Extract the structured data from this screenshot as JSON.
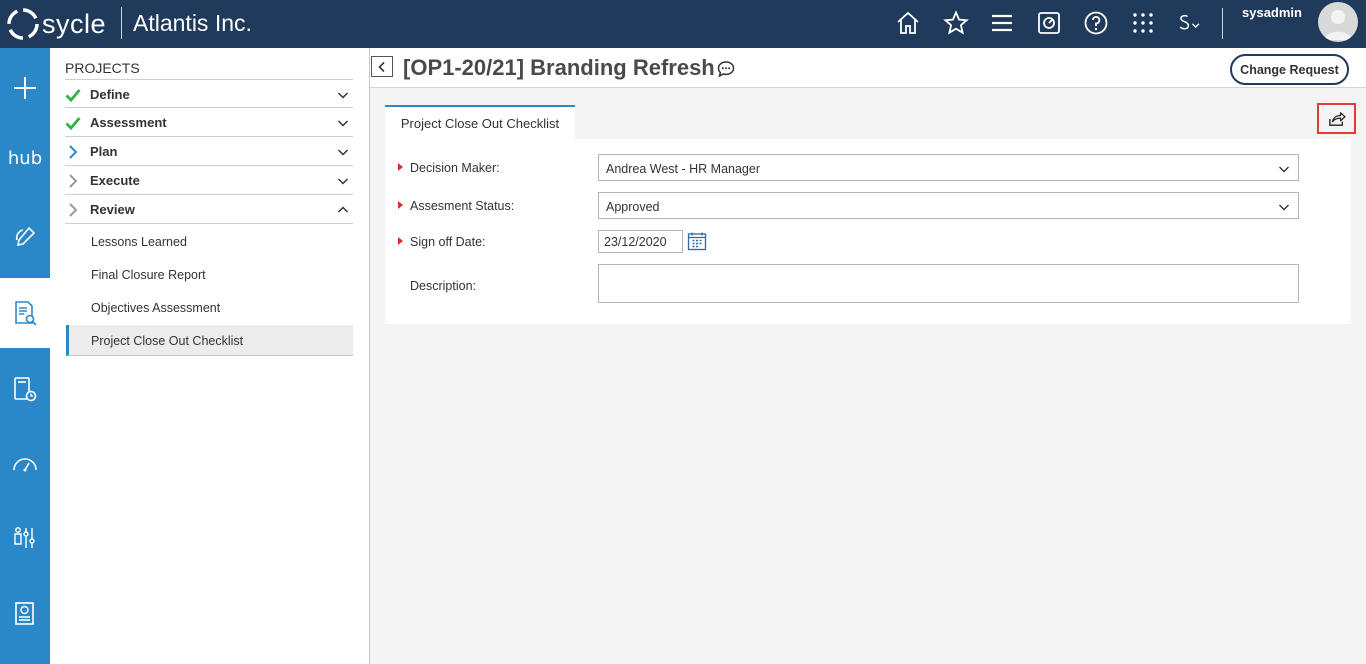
{
  "app": {
    "brand": "sycle",
    "company": "Atlantis Inc.",
    "user": "sysadmin"
  },
  "topbar_icons": [
    "home-icon",
    "star-icon",
    "menu-icon",
    "chart-icon",
    "help-icon",
    "apps-grid-icon",
    "s-dropdown-icon"
  ],
  "rail": {
    "hub_label": "hub"
  },
  "projects": {
    "title": "PROJECTS",
    "stages": [
      {
        "label": "Define",
        "status": "complete",
        "expanded": false
      },
      {
        "label": "Assessment",
        "status": "complete",
        "expanded": false
      },
      {
        "label": "Plan",
        "status": "current",
        "expanded": false
      },
      {
        "label": "Execute",
        "status": "pending",
        "expanded": false
      },
      {
        "label": "Review",
        "status": "pending",
        "expanded": true
      }
    ],
    "review_items": [
      {
        "label": "Lessons Learned"
      },
      {
        "label": "Final Closure Report"
      },
      {
        "label": "Objectives Assessment"
      },
      {
        "label": "Project Close Out Checklist",
        "active": true
      }
    ]
  },
  "main": {
    "title": "[OP1-20/21] Branding Refresh",
    "change_request_label": "Change Request",
    "tab_label": "Project Close Out Checklist",
    "form": {
      "decision_maker": {
        "label": "Decision Maker:",
        "value": "Andrea West - HR Manager",
        "required": true
      },
      "assessment_status": {
        "label": "Assesment Status:",
        "value": "Approved",
        "required": true
      },
      "sign_off_date": {
        "label": "Sign off Date:",
        "value": "23/12/2020",
        "required": true
      },
      "description": {
        "label": "Description:",
        "value": ""
      }
    }
  },
  "colors": {
    "topbar": "#1f3a5a",
    "rail": "#2b88c8",
    "check": "#2fb344",
    "required": "#d32f2f",
    "highlight": "#e53935"
  }
}
